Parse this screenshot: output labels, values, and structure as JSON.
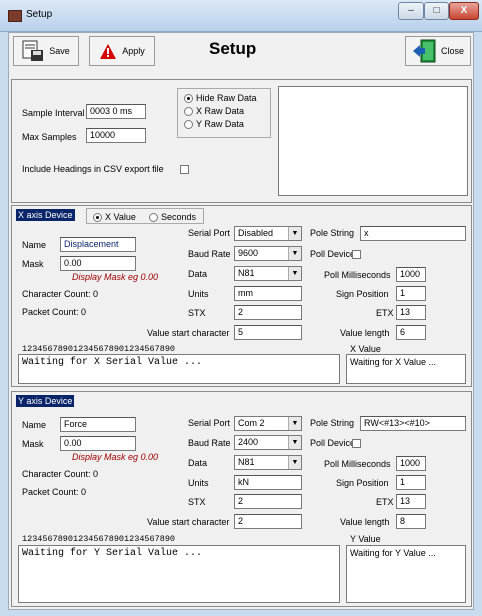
{
  "window": {
    "title": "Setup",
    "min_glyph": "–",
    "max_glyph": "□",
    "close_glyph": "X"
  },
  "toolbar": {
    "save_label": "Save",
    "apply_label": "Apply",
    "heading": "Setup",
    "close_label": "Close"
  },
  "general": {
    "sample_interval_label": "Sample Interval",
    "sample_interval_value": "0003 0 ms",
    "max_samples_label": "Max Samples",
    "max_samples_value": "10000",
    "csv_headings_label": "Include Headings in CSV export file",
    "raw_options": [
      "Hide Raw Data",
      "X Raw Data",
      "Y Raw Data"
    ]
  },
  "x_device": {
    "header": "X axis Device",
    "mode_options": [
      "X Value",
      "Seconds"
    ],
    "name_label": "Name",
    "name_value": "Displacement",
    "mask_label": "Mask",
    "mask_value": "0.00",
    "mask_hint": "Display Mask eg 0.00",
    "char_count": "Character Count:  0",
    "packet_count": "Packet Count:  0",
    "serial_port_label": "Serial Port",
    "serial_port_value": "Disabled",
    "baud_rate_label": "Baud Rate",
    "baud_rate_value": "9600",
    "data_label": "Data",
    "data_value": "N81",
    "units_label": "Units",
    "units_value": "mm",
    "stx_label": "STX",
    "stx_value": "2",
    "value_start_label": "Value start character",
    "value_start_value": "5",
    "pole_string_label": "Pole String",
    "pole_string_value": "x",
    "poll_device_label": "Poll Device",
    "poll_ms_label": "Poll Milliseconds",
    "poll_ms_value": "1000",
    "sign_pos_label": "Sign Position",
    "sign_pos_value": "1",
    "etx_label": "ETX",
    "etx_value": "13",
    "value_length_label": "Value length",
    "value_length_value": "6",
    "ruler": "123456789012345678901234567890",
    "serial_text": "Waiting for X Serial Value ...",
    "value_label": "X Value",
    "value_text": "Waiting for X Value ..."
  },
  "y_device": {
    "header": "Y axis Device",
    "name_label": "Name",
    "name_value": "Force",
    "mask_label": "Mask",
    "mask_value": "0.00",
    "mask_hint": "Display Mask eg 0.00",
    "char_count": "Character Count:  0",
    "packet_count": "Packet Count:  0",
    "serial_port_label": "Serial Port",
    "serial_port_value": "Com 2",
    "baud_rate_label": "Baud Rate",
    "baud_rate_value": "2400",
    "data_label": "Data",
    "data_value": "N81",
    "units_label": "Units",
    "units_value": "kN",
    "stx_label": "STX",
    "stx_value": "2",
    "value_start_label": "Value start character",
    "value_start_value": "2",
    "pole_string_label": "Pole String",
    "pole_string_value": "RW<#13><#10>",
    "poll_device_label": "Poll Device",
    "poll_ms_label": "Poll Milliseconds",
    "poll_ms_value": "1000",
    "sign_pos_label": "Sign Position",
    "sign_pos_value": "1",
    "etx_label": "ETX",
    "etx_value": "13",
    "value_length_label": "Value length",
    "value_length_value": "8",
    "ruler": "123456789012345678901234567890",
    "serial_text": "Waiting for Y Serial Value ...",
    "value_label": "Y Value",
    "value_text": "Waiting for Y Value ..."
  }
}
